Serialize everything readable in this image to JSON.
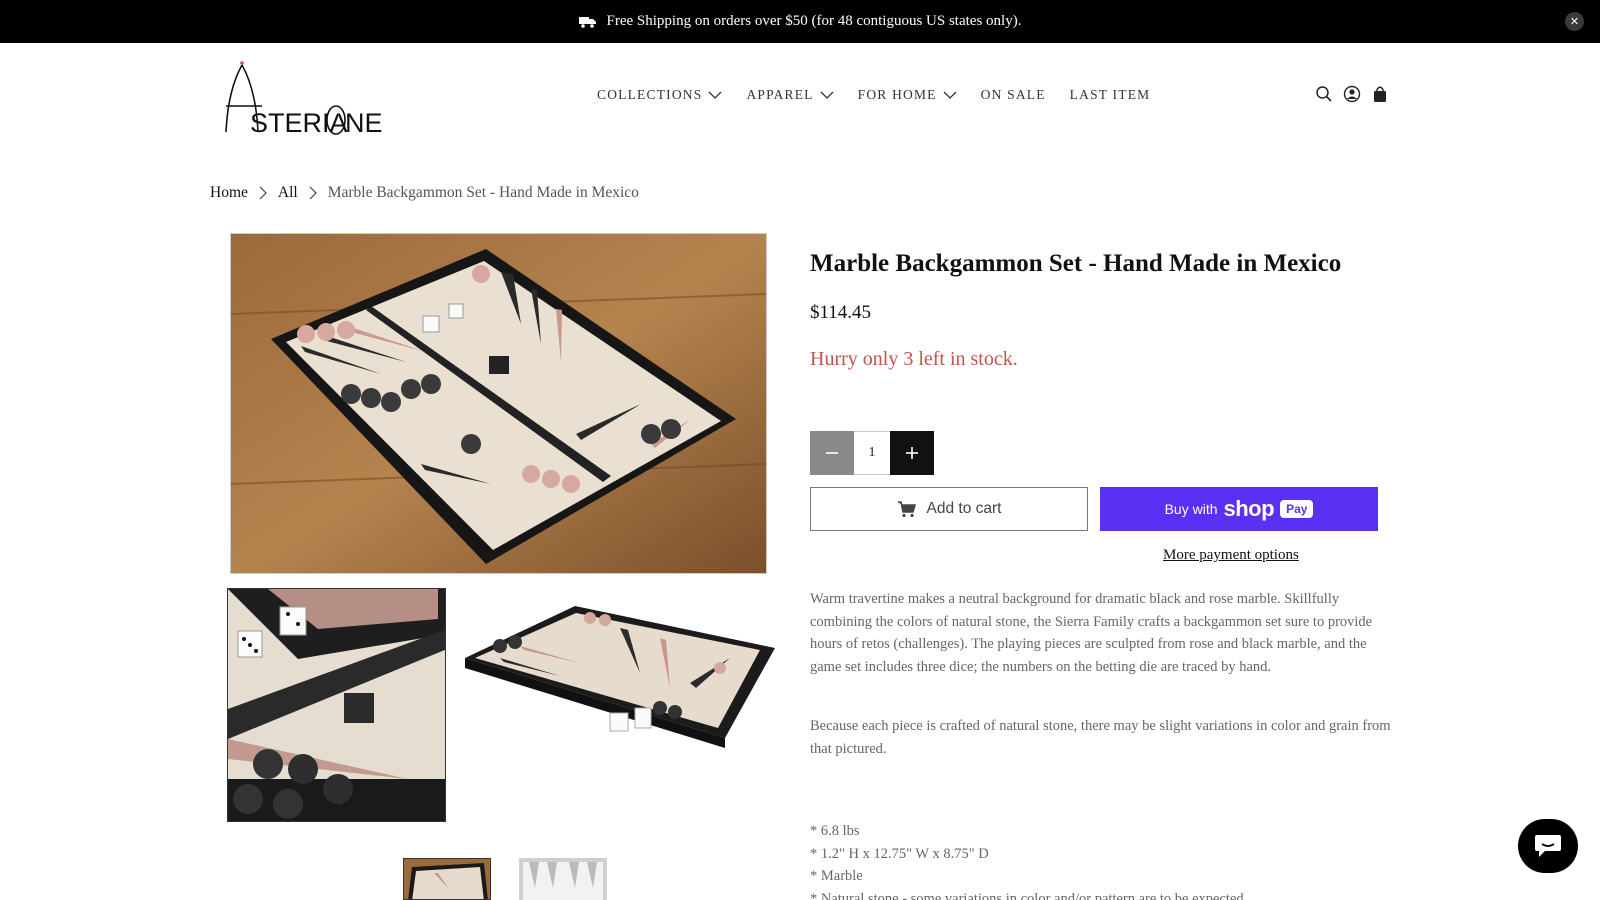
{
  "announcement": {
    "text": "Free Shipping on orders over $50 (for 48 contiguous US states only).",
    "icon": "truck-icon",
    "close_icon": "close-icon"
  },
  "header": {
    "logo_text": "ASTERIA ONE",
    "nav": [
      {
        "label": "COLLECTIONS",
        "has_dropdown": true
      },
      {
        "label": "APPAREL",
        "has_dropdown": true
      },
      {
        "label": "FOR HOME",
        "has_dropdown": true
      },
      {
        "label": "ON SALE",
        "has_dropdown": false
      },
      {
        "label": "LAST ITEM",
        "has_dropdown": false
      }
    ],
    "icons": [
      "search-icon",
      "account-icon",
      "cart-icon"
    ]
  },
  "breadcrumb": {
    "home": "Home",
    "all": "All",
    "current": "Marble Backgammon Set - Hand Made in Mexico"
  },
  "product": {
    "title": "Marble Backgammon Set - Hand Made in Mexico",
    "price": "$114.45",
    "stock": "Hurry only 3 left in stock.",
    "quantity": "1",
    "add_to_cart": "Add to cart",
    "buy_with": "Buy with",
    "shop_brand": "shop",
    "pay_badge": "Pay",
    "more_payment": "More payment options",
    "description": [
      "Warm travertine makes a neutral background for dramatic black and rose marble. Skillfully combining the colors of natural stone, the Sierra Family crafts a backgammon set sure to provide hours of retos (challenges). The playing pieces are sculpted from rose and black marble, and the game set includes three dice; the numbers on the betting die are traced by hand.",
      "Because each piece is crafted of natural stone, there may be slight variations in color and grain from that pictured."
    ],
    "specs": [
      "* 6.8 lbs",
      "* 1.2\" H x 12.75\" W x 8.75\" D",
      "* Marble",
      "* Natural stone - some variations in color and/or pattern are to be expected"
    ]
  },
  "colors": {
    "accent_button": "#5a31f4",
    "stock_text": "#c0554c",
    "announcement_bg": "#000000"
  }
}
